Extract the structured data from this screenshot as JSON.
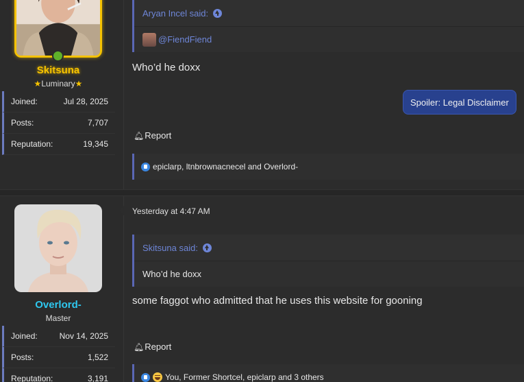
{
  "posts": [
    {
      "user": {
        "name": "Skitsuna",
        "title": "Luminary",
        "title_prefix_icon": "star-icon",
        "title_suffix_icon": "star-icon",
        "online": true,
        "name_color": "#f5c200",
        "stats": [
          {
            "label": "Joined:",
            "value": "Jul 28, 2025"
          },
          {
            "label": "Posts:",
            "value": "7,707"
          },
          {
            "label": "Reputation:",
            "value": "19,345"
          }
        ]
      },
      "quote": {
        "author": "Aryan Incel said:",
        "mention": "@FiendFiend"
      },
      "text": "Who’d he doxx",
      "spoiler_label": "Spoiler: Legal Disclaimer",
      "report_label": "Report",
      "reactions": "epiclarp, ltnbrownacnecel and Overlord-"
    },
    {
      "user": {
        "name": "Overlord-",
        "title": "Master",
        "name_color": "#2ec8f0",
        "stats": [
          {
            "label": "Joined:",
            "value": "Nov 14, 2025"
          },
          {
            "label": "Posts:",
            "value": "1,522"
          },
          {
            "label": "Reputation:",
            "value": "3,191"
          }
        ]
      },
      "timestamp": "Yesterday at 4:47 AM",
      "quote": {
        "author": "Skitsuna said:",
        "text": "Who’d he doxx"
      },
      "text": "some faggot who admitted that he uses this website for gooning",
      "report_label": "Report",
      "reactions": "You, Former Shortcel, epiclarp and 3 others"
    }
  ],
  "colors": {
    "accent": "#5a67b5",
    "link": "#6e86d8",
    "spoiler_bg": "#28418e",
    "online": "#5fb12a"
  }
}
